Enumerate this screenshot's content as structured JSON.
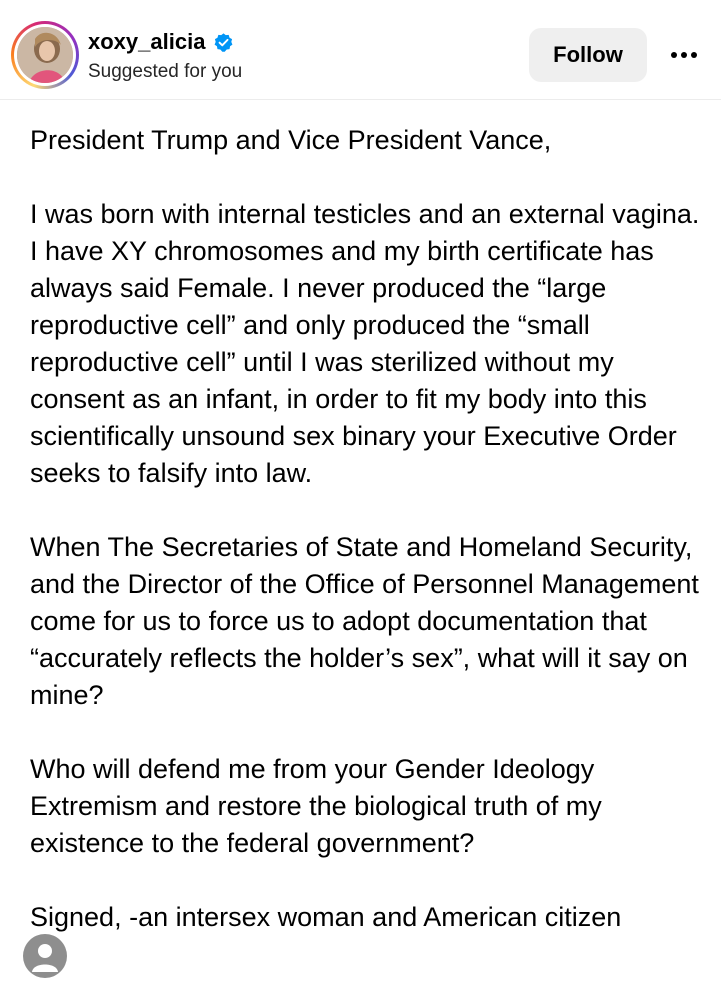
{
  "header": {
    "username": "xoxy_alicia",
    "subtitle": "Suggested for you",
    "follow_label": "Follow",
    "avatar_icon": "profile-photo",
    "verified_icon": "verified-badge-icon",
    "more_icon": "more-horizontal-icon"
  },
  "post": {
    "paragraphs": [
      "President Trump and Vice President Vance,",
      "I was born with internal testicles and an external vagina. I have XY chromosomes and my birth certificate has always said Female. I never produced the “large reproductive cell” and only produced the “small reproductive cell” until I was sterilized without my consent as an infant, in order to fit my body into this scientifically unsound sex binary your Executive Order seeks to falsify into law.",
      "When The Secretaries of State and Homeland Security, and the Director of the Office of Personnel Management come for us to force us to adopt documentation that “accurately reflects the holder’s sex”, what will it say on mine?",
      "Who will defend me from your Gender Ideology Extremism and restore the biological truth of my existence to the federal government?",
      "Signed, -an intersex woman and American citizen"
    ]
  },
  "colors": {
    "verified_blue": "#0095f6",
    "follow_bg": "#efefef",
    "text": "#000000",
    "corner_avatar": "#8e8e8e"
  }
}
